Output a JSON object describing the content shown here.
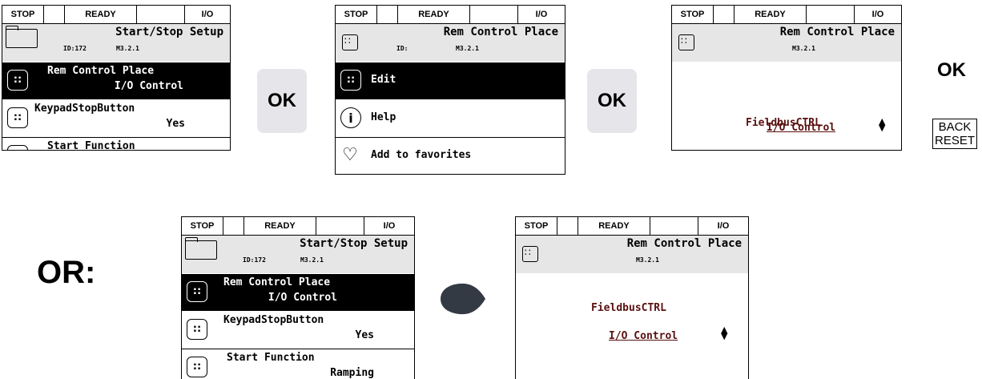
{
  "status": {
    "stop": "STOP",
    "ready": "READY",
    "io": "I/O"
  },
  "s1": {
    "title": "Start/Stop Setup",
    "id": "ID:172",
    "menu": "M3.2.1",
    "rows": [
      {
        "label": "Rem Control Place",
        "value": "I/O Control"
      },
      {
        "label": "KeypadStopButton",
        "value": "Yes"
      },
      {
        "label": "Start Function",
        "value": "Ramping"
      }
    ]
  },
  "s2": {
    "title": "Rem Control Place",
    "id": "ID:",
    "menu": "M3.2.1",
    "items": [
      "Edit",
      "Help",
      "Add to favorites"
    ]
  },
  "s3": {
    "title": "Rem Control Place",
    "menu": "M3.2.1",
    "option1": "FieldbusCTRL",
    "option2": "I/O Control"
  },
  "buttons": {
    "ok": "OK",
    "back": "BACK",
    "reset": "RESET"
  },
  "or_label": "OR:",
  "icons": {
    "folder": "folder-icon",
    "param": "parameter-icon",
    "help": "info-icon",
    "favorite": "heart-plus-icon",
    "arrow": "arrow-blob-icon",
    "updown": "up-down-arrows-icon"
  }
}
